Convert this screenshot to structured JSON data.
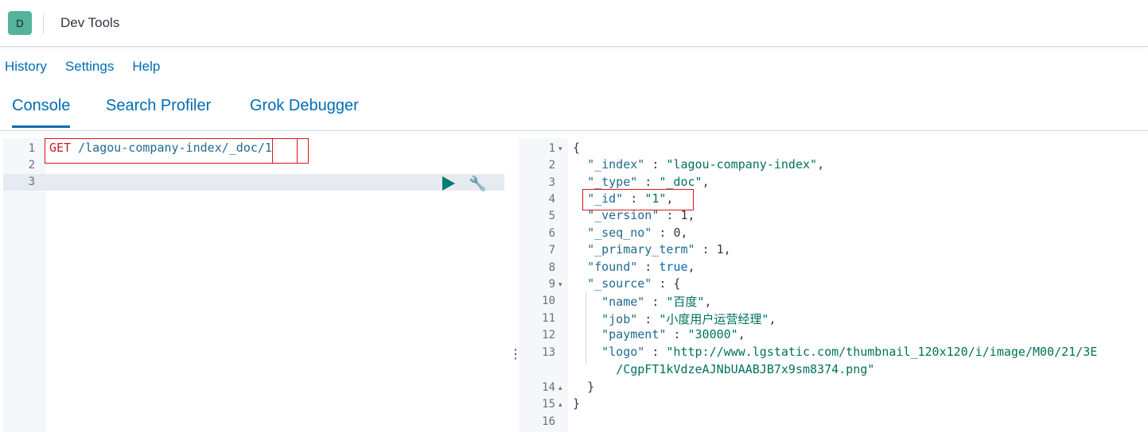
{
  "header": {
    "avatar_letter": "D",
    "app_title": "Dev Tools"
  },
  "menu": [
    "History",
    "Settings",
    "Help"
  ],
  "tabs": [
    "Console",
    "Search Profiler",
    "Grok Debugger"
  ],
  "editor": {
    "line_numbers": [
      "1",
      "2",
      "3"
    ],
    "method": "GET",
    "path": " /lagou-company-index/_doc/1"
  },
  "output": {
    "line_numbers": [
      "1",
      "2",
      "3",
      "4",
      "5",
      "6",
      "7",
      "8",
      "9",
      "10",
      "11",
      "12",
      "13",
      "14",
      "15",
      "16"
    ],
    "fold_markers": {
      "l1": "▾",
      "l9": "▾",
      "l14": "▴",
      "l15": "▴"
    },
    "open_brace": "{",
    "index_key": "\"_index\"",
    "index_val": "\"lagou-company-index\"",
    "type_key": "\"_type\"",
    "type_val": "\"_doc\"",
    "id_key": "\"_id\"",
    "id_val": "\"1\"",
    "version_key": "\"_version\"",
    "version_val": "1",
    "seq_key": "\"_seq_no\"",
    "seq_val": "0",
    "term_key": "\"_primary_term\"",
    "term_val": "1",
    "found_key": "\"found\"",
    "found_val": "true",
    "source_key": "\"_source\"",
    "name_key": "\"name\"",
    "name_val": "\"百度\"",
    "job_key": "\"job\"",
    "job_val": "\"小度用户运营经理\"",
    "payment_key": "\"payment\"",
    "payment_val": "\"30000\"",
    "logo_key": "\"logo\"",
    "logo_val_1": "\"http://www.lgstatic.com/thumbnail_120x120/i/image/M00/21/3E",
    "logo_val_2": "/CgpFT1kVdzeAJNbUAABJB7x9sm8374.png\"",
    "close_inner": "}",
    "close_outer": "}"
  },
  "icons": [
    "play-icon",
    "wrench-icon",
    "resizer-icon"
  ]
}
